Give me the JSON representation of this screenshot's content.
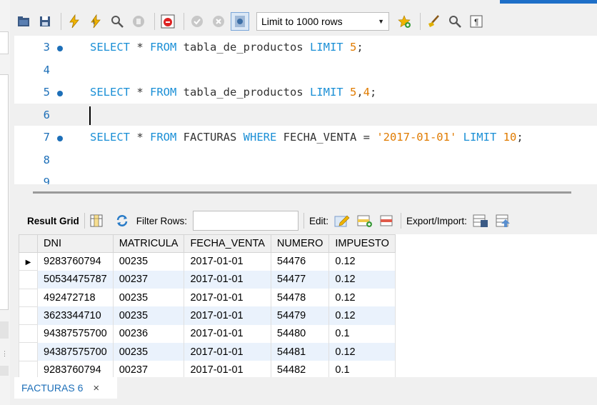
{
  "toolbar": {
    "limit_select_value": "Limit to 1000 rows",
    "icons": [
      "open-folder-icon",
      "save-icon",
      "execute-icon",
      "execute-current-icon",
      "explain-icon",
      "stop-icon",
      "toggle-error-icon",
      "commit-icon",
      "rollback-icon",
      "autocommit-icon",
      "limit-select",
      "beautify-icon",
      "find-icon",
      "word-wrap-icon"
    ]
  },
  "editor": {
    "lines": [
      {
        "num": "3",
        "has_dot": true,
        "tokens": [
          [
            "kw",
            "SELECT"
          ],
          [
            "t",
            " * "
          ],
          [
            "kw",
            "FROM"
          ],
          [
            "t",
            " tabla_de_productos "
          ],
          [
            "kw",
            "LIMIT"
          ],
          [
            "t",
            " "
          ],
          [
            "num",
            "5"
          ],
          [
            "t",
            ";"
          ]
        ]
      },
      {
        "num": "4",
        "has_dot": false,
        "tokens": []
      },
      {
        "num": "5",
        "has_dot": true,
        "tokens": [
          [
            "kw",
            "SELECT"
          ],
          [
            "t",
            " * "
          ],
          [
            "kw",
            "FROM"
          ],
          [
            "t",
            " tabla_de_productos "
          ],
          [
            "kw",
            "LIMIT"
          ],
          [
            "t",
            " "
          ],
          [
            "num",
            "5"
          ],
          [
            "t",
            ","
          ],
          [
            "num",
            "4"
          ],
          [
            "t",
            ";"
          ]
        ]
      },
      {
        "num": "6",
        "has_dot": false,
        "current": true,
        "tokens": []
      },
      {
        "num": "7",
        "has_dot": true,
        "tokens": [
          [
            "kw",
            "SELECT"
          ],
          [
            "t",
            " * "
          ],
          [
            "kw",
            "FROM"
          ],
          [
            "t",
            " FACTURAS "
          ],
          [
            "kw",
            "WHERE"
          ],
          [
            "t",
            " FECHA_VENTA = "
          ],
          [
            "str",
            "'2017-01-01'"
          ],
          [
            "t",
            " "
          ],
          [
            "kw",
            "LIMIT"
          ],
          [
            "t",
            " "
          ],
          [
            "num",
            "10"
          ],
          [
            "t",
            ";"
          ]
        ]
      },
      {
        "num": "8",
        "has_dot": false,
        "tokens": []
      },
      {
        "num": "9",
        "has_dot": false,
        "tokens": []
      }
    ]
  },
  "result_toolbar": {
    "result_grid_label": "Result Grid",
    "filter_rows_label": "Filter Rows:",
    "filter_rows_value": "",
    "edit_label": "Edit:",
    "export_import_label": "Export/Import:"
  },
  "grid": {
    "columns": [
      "DNI",
      "MATRICULA",
      "FECHA_VENTA",
      "NUMERO",
      "IMPUESTO"
    ],
    "rows": [
      [
        "9283760794",
        "00235",
        "2017-01-01",
        "54476",
        "0.12"
      ],
      [
        "50534475787",
        "00237",
        "2017-01-01",
        "54477",
        "0.12"
      ],
      [
        "492472718",
        "00235",
        "2017-01-01",
        "54478",
        "0.12"
      ],
      [
        "3623344710",
        "00235",
        "2017-01-01",
        "54479",
        "0.12"
      ],
      [
        "94387575700",
        "00236",
        "2017-01-01",
        "54480",
        "0.1"
      ],
      [
        "94387575700",
        "00235",
        "2017-01-01",
        "54481",
        "0.12"
      ],
      [
        "9283760794",
        "00237",
        "2017-01-01",
        "54482",
        "0.1"
      ]
    ],
    "selected_row_marker": "▶"
  },
  "tabs": [
    {
      "label": "FACTURAS 6",
      "close": "×"
    }
  ],
  "colors": {
    "keyword": "#1a8fd6",
    "number": "#e07b00",
    "line_number": "#1d6fb8",
    "row_alt": "#eaf2fc",
    "tab_text": "#1d6fb8"
  }
}
